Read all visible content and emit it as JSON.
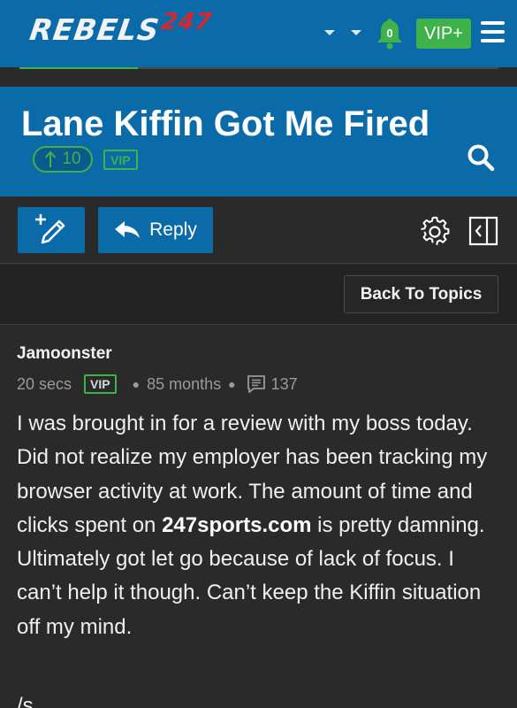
{
  "nav": {
    "logo_main": "REBELS",
    "logo_num": "247",
    "notifications": "0",
    "vip_plus": "VIP+"
  },
  "thread": {
    "title": "Lane Kiffin Got Me Fired",
    "upvotes": "10",
    "badge": "VIP"
  },
  "actions": {
    "reply_label": "Reply",
    "back_label": "Back To Topics"
  },
  "post": {
    "author": "Jamoonster",
    "time": "20 secs",
    "badge": "VIP",
    "tenure": "85 months",
    "post_count": "137",
    "body_part1": "I was brought in for a review with my boss today. Did not realize my employer has been tracking my browser activity at work. The amount of time and clicks spent on ",
    "body_link": "247sports.com",
    "body_part2": " is pretty damning. Ultimately got let go because of lack of focus. I can’t help it though. Can’t keep the Kiffin situation off my mind.",
    "signature": "/s"
  },
  "colors": {
    "brand_blue": "#0b6aa8",
    "accent_green": "#3fb24a",
    "logo_red": "#d9262c",
    "background": "#2a2a2a"
  },
  "icons": [
    "chevron-down-icon",
    "bell-icon",
    "hamburger-menu-icon",
    "upvote-arrow-icon",
    "search-icon",
    "new-post-pencil-icon",
    "reply-arrow-icon",
    "gear-icon",
    "collapse-sidebar-icon",
    "posts-count-icon"
  ]
}
